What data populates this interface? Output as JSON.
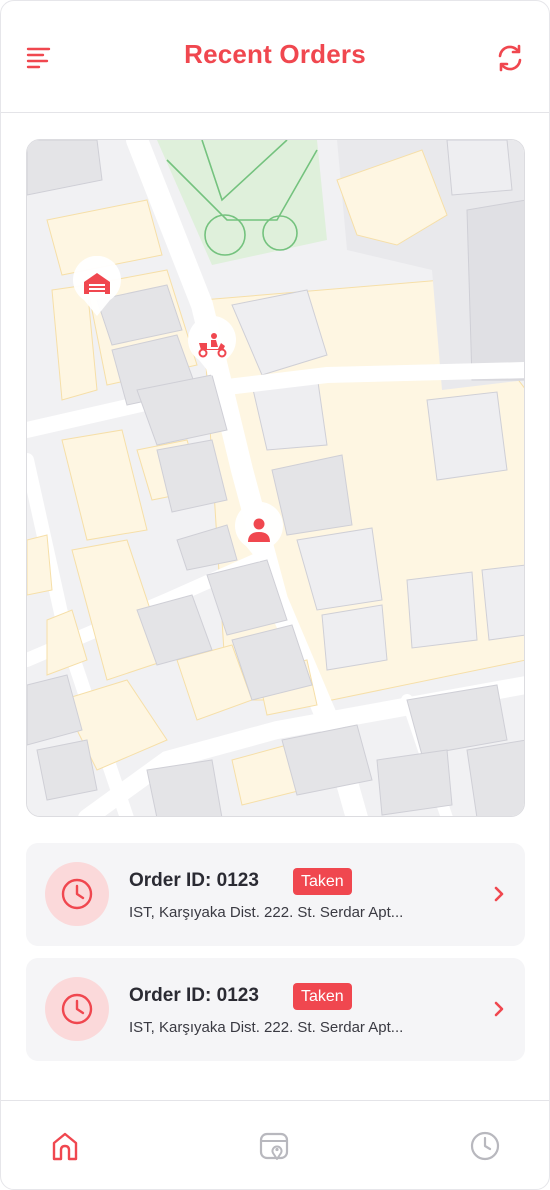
{
  "header": {
    "title": "Recent Orders",
    "menu_icon": "menu-icon",
    "refresh_icon": "refresh-icon"
  },
  "map": {
    "markers": [
      {
        "name": "warehouse-marker",
        "icon": "warehouse-icon"
      },
      {
        "name": "courier-marker",
        "icon": "scooter-icon"
      },
      {
        "name": "customer-marker",
        "icon": "person-icon"
      }
    ]
  },
  "orders": [
    {
      "id_label": "Order ID: 0123",
      "status": "Taken",
      "address": "IST, Karşıyaka Dist. 222. St. Serdar Apt...",
      "icon": "clock-icon"
    },
    {
      "id_label": "Order ID: 0123",
      "status": "Taken",
      "address": "IST, Karşıyaka Dist. 222. St. Serdar Apt...",
      "icon": "clock-icon"
    }
  ],
  "tabbar": {
    "items": [
      {
        "name": "home",
        "icon": "home-icon",
        "active": true
      },
      {
        "name": "map",
        "icon": "map-pin-icon",
        "active": false
      },
      {
        "name": "history",
        "icon": "clock-icon",
        "active": false
      }
    ]
  },
  "colors": {
    "accent": "#f0474f",
    "accent_light": "#fbd9da",
    "card_bg": "#f5f5f7",
    "map_block": "#fef6e2",
    "map_building": "#e4e4e7",
    "map_park": "#dff0db",
    "inactive_icon": "#b8b8be"
  }
}
